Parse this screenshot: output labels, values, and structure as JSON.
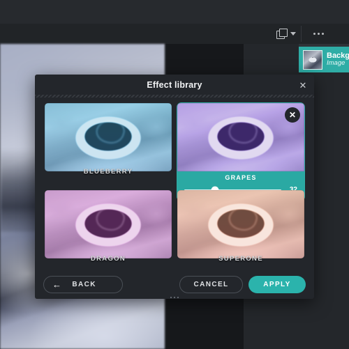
{
  "toolbar": {
    "duplicate_icon": "duplicate-layer-icon",
    "caret_icon": "chevron-down-icon",
    "overflow_icon": "more-options-icon"
  },
  "layers_panel": {
    "item": {
      "name": "Background",
      "kind": "Image"
    }
  },
  "dialog": {
    "title": "Effect library",
    "close_label": "✕",
    "effects": [
      {
        "name": "BLUEBERRY",
        "selected": false,
        "tint": "blueberry",
        "accent": "#52a0ba"
      },
      {
        "name": "GRAPES",
        "selected": true,
        "tint": "grapes",
        "accent": "#7456b2",
        "remove_label": "✕",
        "slider": {
          "label": "GRAPES",
          "value": "32",
          "min": 0,
          "max": 100,
          "percent": 32
        }
      },
      {
        "name": "DRAGON",
        "selected": false,
        "tint": "dragon",
        "accent": "#965296"
      },
      {
        "name": "SUPERONE",
        "selected": false,
        "tint": "superone",
        "accent": "#d69670"
      }
    ],
    "buttons": {
      "back": "BACK",
      "back_icon": "←",
      "cancel": "CANCEL",
      "apply": "APPLY"
    }
  },
  "colors": {
    "accent_teal": "#2bb3ac",
    "panel_bg": "#23262b",
    "app_bg": "#16181b"
  }
}
